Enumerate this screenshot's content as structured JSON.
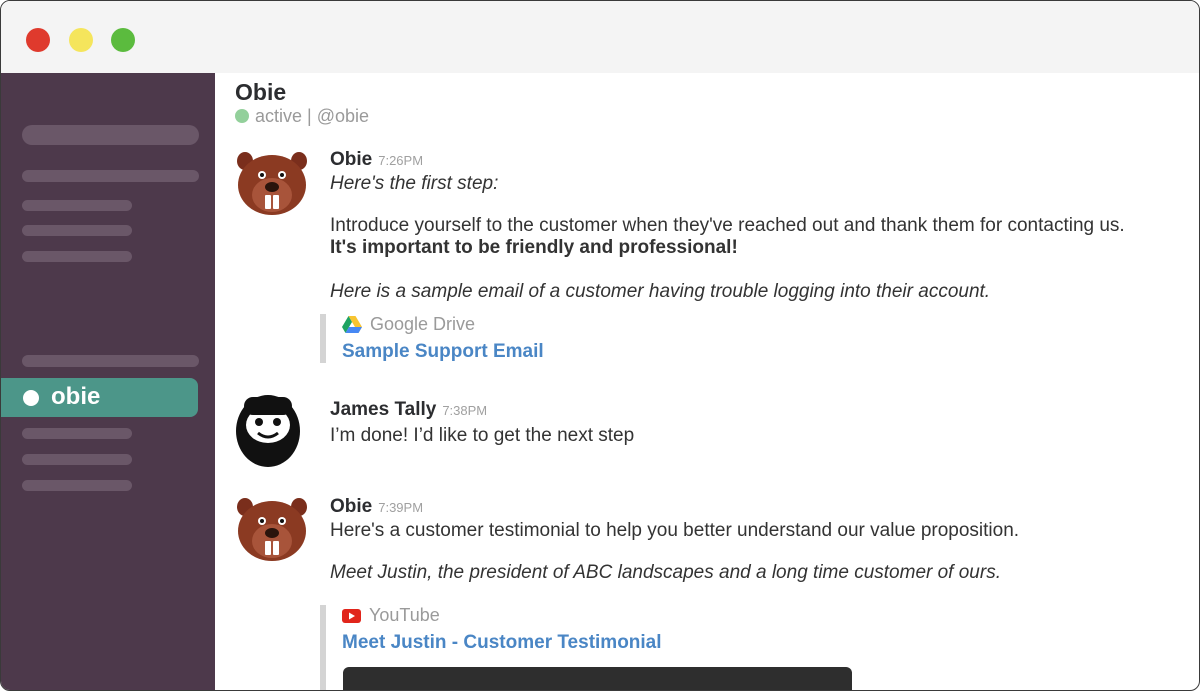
{
  "sidebar": {
    "active_channel": "obie"
  },
  "header": {
    "name": "Obie",
    "status": "active | @obie"
  },
  "messages": [
    {
      "author": "Obie",
      "time": "7:26PM",
      "avatar": "beaver-avatar",
      "lines": [
        "Here's the first step:",
        "Introduce yourself to the customer when they've reached out and thank them for contacting us.",
        "It's important to be friendly and professional!",
        "Here is a sample email of a customer having trouble logging into their account."
      ],
      "attachment": {
        "service": "Google Drive",
        "title": "Sample Support Email",
        "icon": "google-drive-icon"
      }
    },
    {
      "author": "James Tally",
      "time": "7:38PM",
      "avatar": "bearded-man-avatar",
      "lines": [
        "I’m done! I’d like to get the next step"
      ]
    },
    {
      "author": "Obie",
      "time": "7:39PM",
      "avatar": "beaver-avatar",
      "lines": [
        "Here's a customer testimonial to help you better understand our value proposition.",
        "Meet Justin, the president of ABC landscapes and a long time customer of ours."
      ],
      "attachment": {
        "service": "YouTube",
        "title": "Meet Justin - Customer Testimonial",
        "icon": "youtube-icon"
      }
    }
  ],
  "colors": {
    "sidebar": "#4d394b",
    "active_channel": "#4c9689",
    "link": "#4a86c5",
    "presence": "#93d09b"
  }
}
